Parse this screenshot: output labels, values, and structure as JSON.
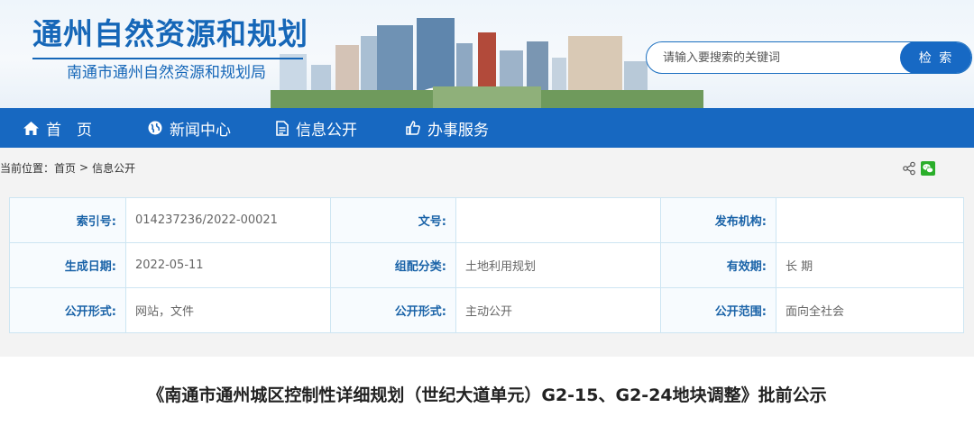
{
  "header": {
    "title": "通州自然资源和规划",
    "subtitle": "南通市通州自然资源和规划局",
    "search_placeholder": "请输入要搜索的关键词",
    "search_button": "检 索"
  },
  "nav": {
    "items": [
      {
        "label": "首　页",
        "icon": "home-icon"
      },
      {
        "label": "新闻中心",
        "icon": "globe-icon"
      },
      {
        "label": "信息公开",
        "icon": "document-icon"
      },
      {
        "label": "办事服务",
        "icon": "thumbs-up-icon"
      }
    ]
  },
  "breadcrumb": {
    "prefix": "当前位置：",
    "home": "首页",
    "separator": ">",
    "current": "信息公开"
  },
  "meta": {
    "rows": [
      [
        {
          "label": "索引号:",
          "value": "014237236/2022-00021"
        },
        {
          "label": "文号:",
          "value": ""
        },
        {
          "label": "发布机构:",
          "value": ""
        }
      ],
      [
        {
          "label": "生成日期:",
          "value": "2022-05-11"
        },
        {
          "label": "组配分类:",
          "value": "土地利用规划"
        },
        {
          "label": "有效期:",
          "value": "长 期"
        }
      ],
      [
        {
          "label": "公开形式:",
          "value": "网站，文件"
        },
        {
          "label": "公开形式:",
          "value": "主动公开"
        },
        {
          "label": "公开范围:",
          "value": "面向全社会"
        }
      ]
    ]
  },
  "article": {
    "title": "《南通市通州城区控制性详细规划（世纪大道单元）G2-15、G2-24地块调整》批前公示"
  },
  "colors": {
    "brand_blue": "#1768c1",
    "label_blue": "#1a63a8",
    "table_border": "#cde5f2",
    "wechat_green": "#2aae2a"
  }
}
